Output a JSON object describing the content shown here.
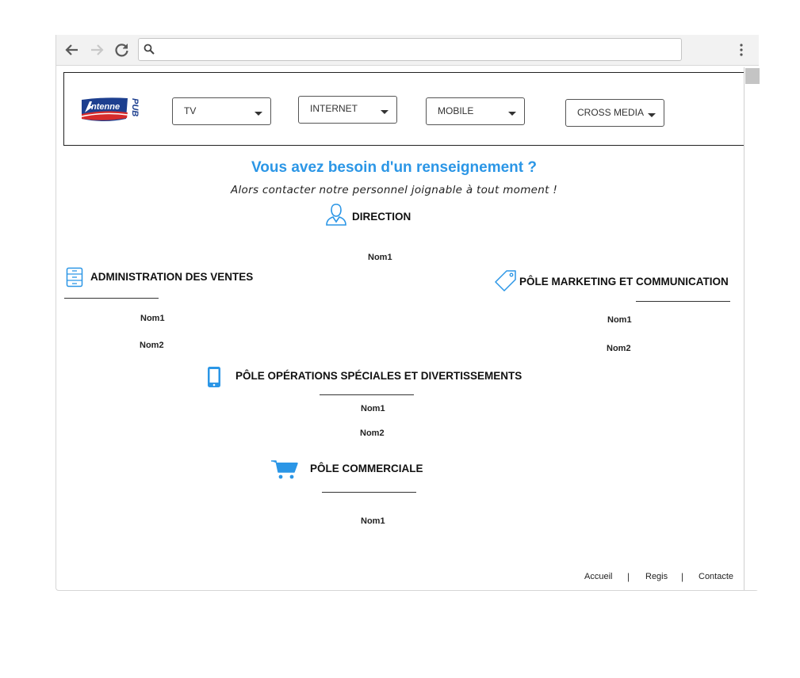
{
  "browser": {
    "address_value": "",
    "icons": [
      "back-arrow-icon",
      "forward-arrow-icon",
      "reload-icon",
      "search-icon",
      "more-vertical-icon"
    ]
  },
  "header": {
    "logo_alt": "Antenne PUB",
    "menus": [
      {
        "label": "TV"
      },
      {
        "label": "INTERNET"
      },
      {
        "label": "MOBILE"
      },
      {
        "label": "CROSS MEDIA"
      }
    ]
  },
  "main": {
    "title": "Vous avez besoin d'un renseignement ?",
    "subtitle": "Alors contacter notre personnel joignable à tout moment !",
    "accent_color": "#2b96e6",
    "sections": {
      "direction": {
        "title": "DIRECTION",
        "icon": "person-icon",
        "names": [
          "Nom1"
        ]
      },
      "admin_ventes": {
        "title": "ADMINISTRATION DES VENTES",
        "icon": "cabinet-icon",
        "names": [
          "Nom1",
          "Nom2"
        ]
      },
      "marketing": {
        "title": "PÔLE MARKETING ET COMMUNICATION",
        "icon": "tag-icon",
        "names": [
          "Nom1",
          "Nom2"
        ]
      },
      "operations": {
        "title": "PÔLE OPÉRATIONS SPÉCIALES ET DIVERTISSEMENTS",
        "icon": "phone-icon",
        "names": [
          "Nom1",
          "Nom2"
        ]
      },
      "commercial": {
        "title": "PÔLE COMMERCIALE",
        "icon": "cart-icon",
        "names": [
          "Nom1"
        ]
      }
    }
  },
  "footer": {
    "links": [
      "Accueil",
      "Regis",
      "Contacte"
    ],
    "separator": "|"
  }
}
